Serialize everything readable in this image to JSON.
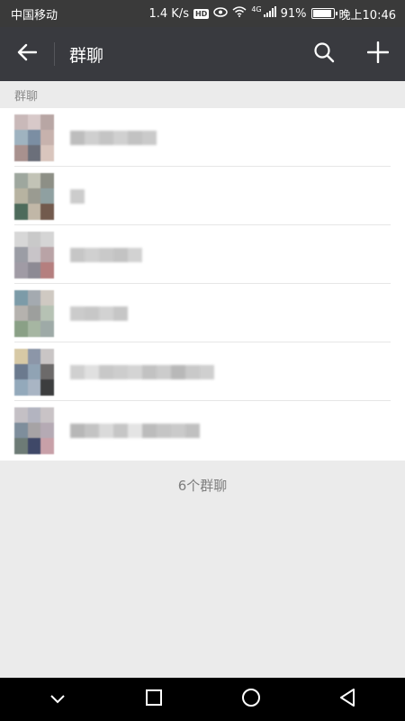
{
  "status_bar": {
    "carrier": "中国移动",
    "speed": "1.4 K/s",
    "hd_badge": "HD",
    "network": "4G",
    "battery": "91%",
    "time": "晚上10:46"
  },
  "app_bar": {
    "title": "群聊",
    "back_icon": "arrow-left-icon",
    "search_icon": "search-icon",
    "add_icon": "plus-icon"
  },
  "section": {
    "header": "群聊"
  },
  "groups": [
    {
      "avatar_colors": [
        "#c9b9b9",
        "#d8c9c9",
        "#b8a6a4",
        "#9fb3c0",
        "#7b8ea3",
        "#c7b2ad",
        "#a8918e",
        "#6b6f7a",
        "#d9c5bd"
      ],
      "name_blocks": [
        "#bdbdbd",
        "#cfcfcf",
        "#c4c4c4",
        "#d0d0d0",
        "#c2c2c2",
        "#cacaca"
      ]
    },
    {
      "avatar_colors": [
        "#9ea79e",
        "#c2c3b6",
        "#8d8f86",
        "#b7b3a1",
        "#9a9b91",
        "#8fa0a1",
        "#4d6b5b",
        "#c1b7a7",
        "#725a4d"
      ],
      "name_blocks": [
        "#cccccc"
      ]
    },
    {
      "avatar_colors": [
        "#d7d7d7",
        "#c9c9c9",
        "#d5d5d5",
        "#9b9da5",
        "#c8c4c8",
        "#b9a3a6",
        "#a09ba5",
        "#8d8a94",
        "#b57f7f"
      ],
      "name_blocks": [
        "#c6c6c6",
        "#d0d0d0",
        "#c9c9c9",
        "#c3c3c3",
        "#d2d2d2"
      ]
    },
    {
      "avatar_colors": [
        "#7c9ba8",
        "#a4aab0",
        "#cfc9c2",
        "#b5b2ae",
        "#9d9f9d",
        "#b6c2b4",
        "#8aa086",
        "#a6b6a2",
        "#9eaaa7"
      ],
      "name_blocks": [
        "#cbcbcb",
        "#c7c7c7",
        "#d2d2d2",
        "#c6c6c6"
      ]
    },
    {
      "avatar_colors": [
        "#d7c9a5",
        "#8c96a8",
        "#c9c5c5",
        "#6b7a8e",
        "#90a3b4",
        "#6c6a6a",
        "#93a9bb",
        "#a9b5c4",
        "#3c3d3e"
      ],
      "name_blocks": [
        "#d0d0d0",
        "#e0e0e0",
        "#c8c8c8",
        "#cdcdcd",
        "#d4d4d4",
        "#c2c2c2",
        "#cccccc",
        "#b8b8b8",
        "#c9c9c9",
        "#cfcfcf"
      ]
    },
    {
      "avatar_colors": [
        "#c4c0c5",
        "#b3b4c0",
        "#c9c3c6",
        "#7e8e9c",
        "#a6a3a5",
        "#b5aab4",
        "#6d7b76",
        "#3f4868",
        "#c8a0a8"
      ],
      "name_blocks": [
        "#b7b7b7",
        "#c3c3c3",
        "#dadada",
        "#c6c6c6",
        "#e4e4e4",
        "#bcbcbc",
        "#c5c5c5",
        "#cacaca",
        "#c0c0c0"
      ]
    }
  ],
  "footer": {
    "count_text": "6个群聊"
  },
  "nav_bar": {
    "collapse_icon": "chevron-down-icon",
    "recents_icon": "square-icon",
    "home_icon": "circle-icon",
    "back_icon": "triangle-back-icon"
  }
}
